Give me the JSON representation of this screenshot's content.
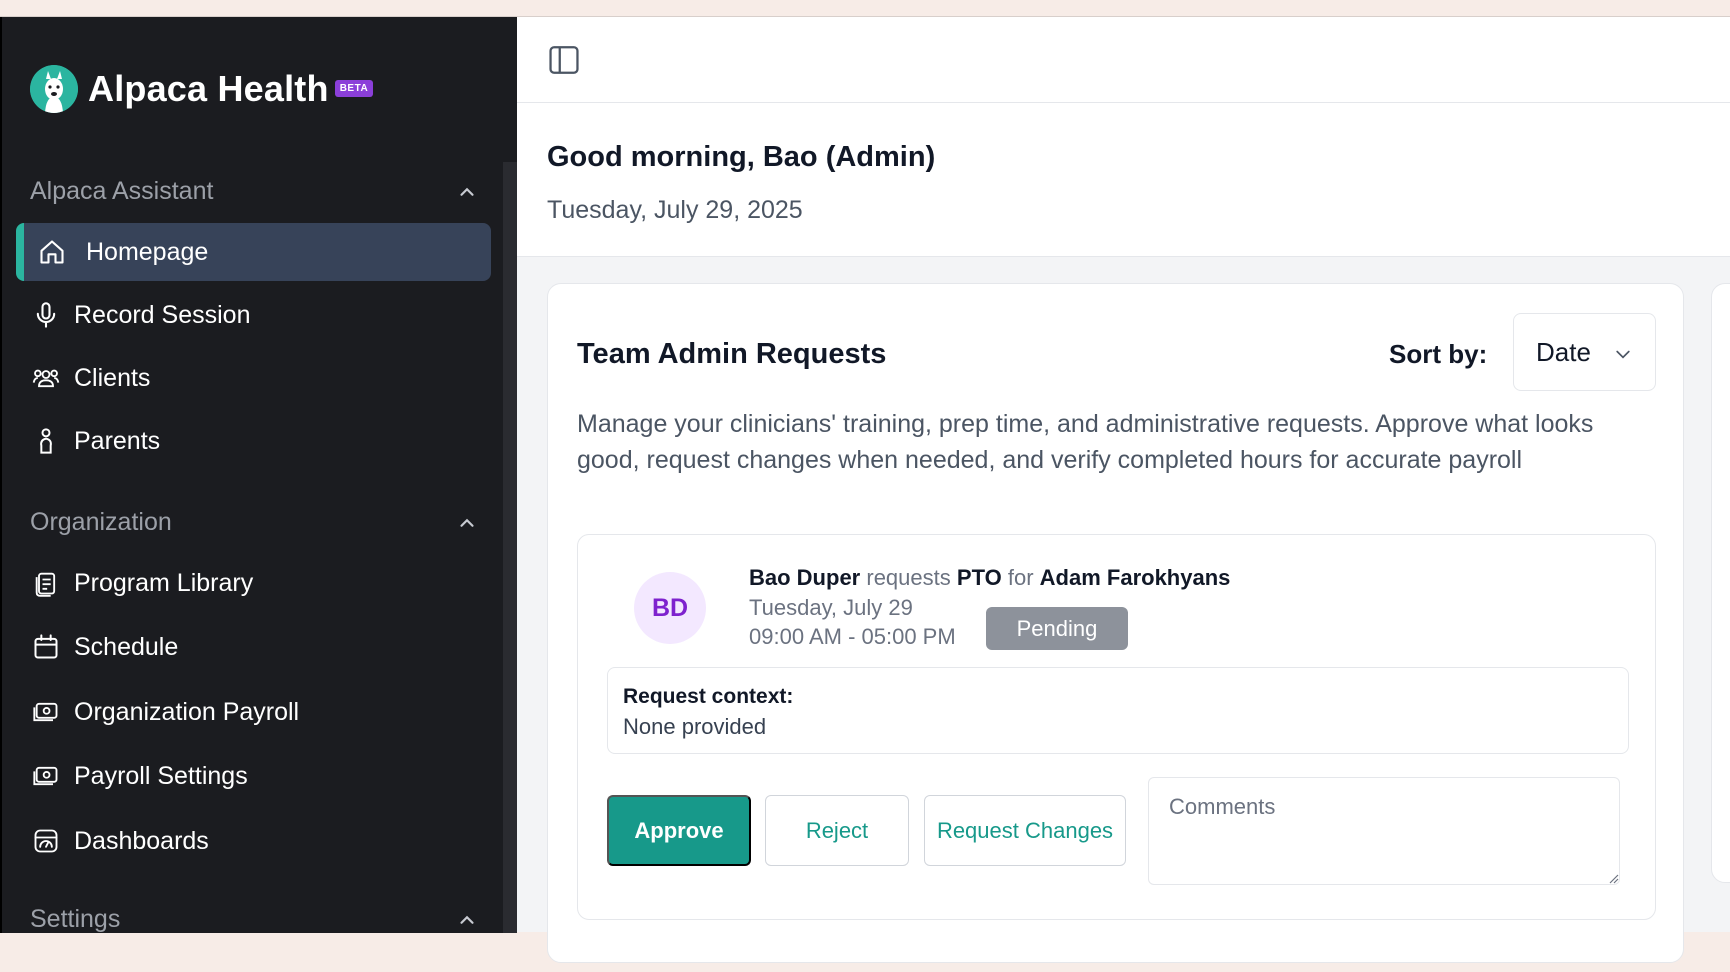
{
  "brand": {
    "name": "Alpaca Health",
    "badge": "BETA"
  },
  "sidebar": {
    "sections": [
      {
        "title": "Alpaca Assistant"
      },
      {
        "title": "Organization"
      },
      {
        "title": "Settings"
      }
    ],
    "assistant_items": [
      {
        "label": "Homepage",
        "icon": "home-icon",
        "active": true
      },
      {
        "label": "Record Session",
        "icon": "microphone-icon"
      },
      {
        "label": "Clients",
        "icon": "users-icon"
      },
      {
        "label": "Parents",
        "icon": "person-icon"
      }
    ],
    "organization_items": [
      {
        "label": "Program Library",
        "icon": "document-icon"
      },
      {
        "label": "Schedule",
        "icon": "calendar-icon"
      },
      {
        "label": "Organization Payroll",
        "icon": "payroll-icon"
      },
      {
        "label": "Payroll Settings",
        "icon": "payroll-settings-icon"
      },
      {
        "label": "Dashboards",
        "icon": "dashboard-icon"
      }
    ]
  },
  "greeting": {
    "title": "Good morning, Bao (Admin)",
    "date": "Tuesday, July 29, 2025"
  },
  "card": {
    "title": "Team Admin Requests",
    "sort_label": "Sort by:",
    "sort_value": "Date",
    "description": "Manage your clinicians' training, prep time, and administrative requests. Approve what looks good, request changes when needed, and verify completed hours for accurate payroll"
  },
  "request": {
    "avatar_initials": "BD",
    "requester": "Bao Duper",
    "verb": "requests",
    "type": "PTO",
    "for_word": "for",
    "subject": "Adam Farokhyans",
    "date": "Tuesday, July 29",
    "time": "09:00 AM - 05:00 PM",
    "status": "Pending",
    "context_label": "Request context:",
    "context_value": "None provided",
    "approve_label": "Approve",
    "reject_label": "Reject",
    "changes_label": "Request Changes",
    "comments_placeholder": "Comments"
  },
  "colors": {
    "accent": "#2bb5a0",
    "primary_button": "#17998a",
    "sidebar_bg": "#1b1c20",
    "active_item_bg": "#374359",
    "beta_badge": "#8b3fd9",
    "pending_badge": "#8d929b"
  }
}
